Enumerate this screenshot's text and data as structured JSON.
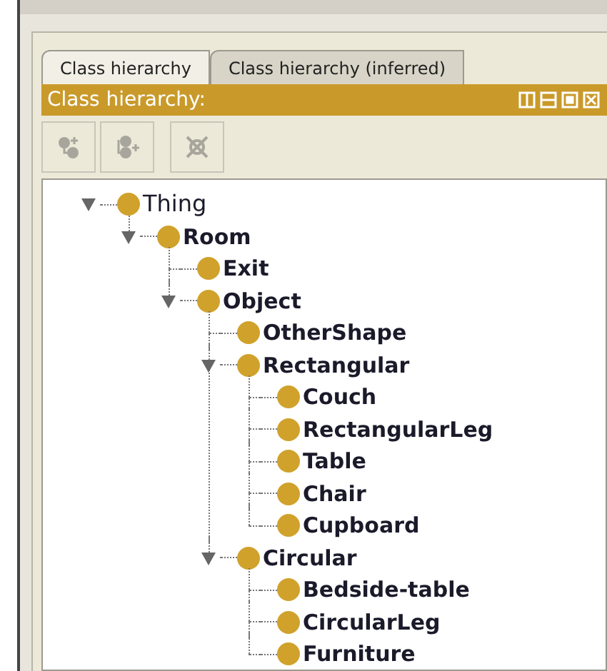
{
  "tabs": [
    {
      "label": "Class hierarchy",
      "selected": true
    },
    {
      "label": "Class hierarchy (inferred)",
      "selected": false
    }
  ],
  "panel": {
    "title": "Class hierarchy:"
  },
  "toolbar": [
    {
      "kind": "add-subclass",
      "disabled": true
    },
    {
      "kind": "add-sibling",
      "disabled": true
    },
    {
      "kind": "delete",
      "disabled": true
    }
  ],
  "tree": [
    {
      "label": "Thing",
      "expanded": true,
      "children": [
        {
          "label": "Room",
          "expanded": true,
          "children": [
            {
              "label": "Exit"
            },
            {
              "label": "Object",
              "expanded": true,
              "children": [
                {
                  "label": "OtherShape"
                },
                {
                  "label": "Rectangular",
                  "expanded": true,
                  "children": [
                    {
                      "label": "Couch"
                    },
                    {
                      "label": "RectangularLeg"
                    },
                    {
                      "label": "Table"
                    },
                    {
                      "label": "Chair"
                    },
                    {
                      "label": "Cupboard"
                    }
                  ]
                },
                {
                  "label": "Circular",
                  "expanded": true,
                  "children": [
                    {
                      "label": "Bedside-table"
                    },
                    {
                      "label": "CircularLeg"
                    },
                    {
                      "label": "Furniture"
                    }
                  ]
                }
              ]
            }
          ]
        }
      ]
    }
  ]
}
